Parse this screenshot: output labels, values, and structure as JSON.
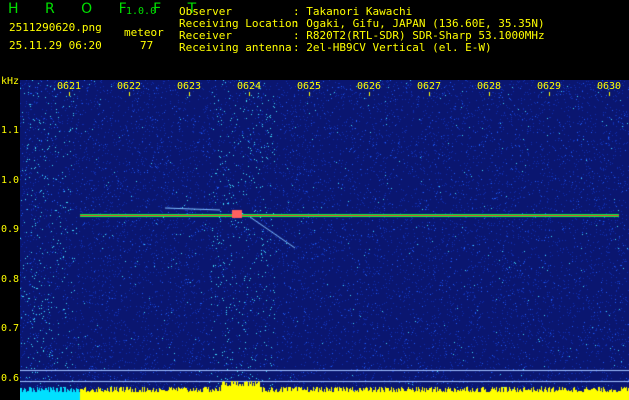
{
  "header": {
    "app_name": "H R O F F T",
    "version": "1.0.0",
    "filename": "2511290620.png",
    "datetime": "25.11.29 06:20",
    "meteor_label": "meteor",
    "meteor_count": "77",
    "info": [
      {
        "label": "Observer",
        "value": ": Takanori Kawachi"
      },
      {
        "label": "Receiving Location",
        "value": ": Ogaki, Gifu, JAPAN (136.60E, 35.35N)"
      },
      {
        "label": "Receiver",
        "value": ": R820T2(RTL-SDR) SDR-Sharp 53.1000MHz"
      },
      {
        "label": "Receiving antenna",
        "value": ": 2el-HB9CV Vertical (el. E-W)"
      }
    ]
  },
  "spectrogram": {
    "y_unit": "kHz",
    "y_ticks": [
      "1.1",
      "1.0",
      "0.9",
      "0.8",
      "0.7",
      "0.6"
    ],
    "x_ticks": [
      "0621",
      "0622",
      "0623",
      "0624",
      "0625",
      "0626",
      "0627",
      "0628",
      "0629",
      "0630"
    ],
    "colors": {
      "background": "#0a1670",
      "carrier": "#00ff40",
      "signal_bar": "#ffff00",
      "text": "#ffff00",
      "logo": "#00e000"
    }
  }
}
